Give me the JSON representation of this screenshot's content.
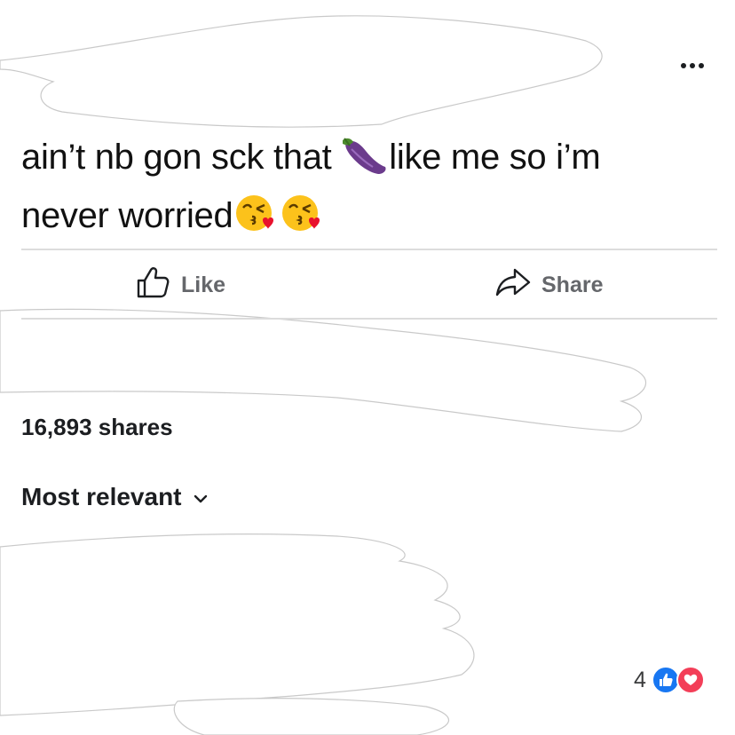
{
  "post": {
    "text_line1_a": "ain’t nb gon sck that ",
    "text_line1_b": "like me so i’m",
    "text_line2": "never worried",
    "emojis": [
      "eggplant-emoji",
      "kissing-face-emoji",
      "kissing-face-emoji"
    ]
  },
  "actions": {
    "like_label": "Like",
    "share_label": "Share"
  },
  "stats": {
    "shares": "16,893 shares"
  },
  "comments": {
    "sort_label": "Most relevant",
    "sort_icon": "chevron-down-icon",
    "reaction_count": "4",
    "reaction_icons": [
      "like-reaction-icon",
      "love-reaction-icon"
    ]
  },
  "colors": {
    "like_blue": "#1877f2",
    "love_red": "#f33e58",
    "action_gray": "#65676b"
  }
}
